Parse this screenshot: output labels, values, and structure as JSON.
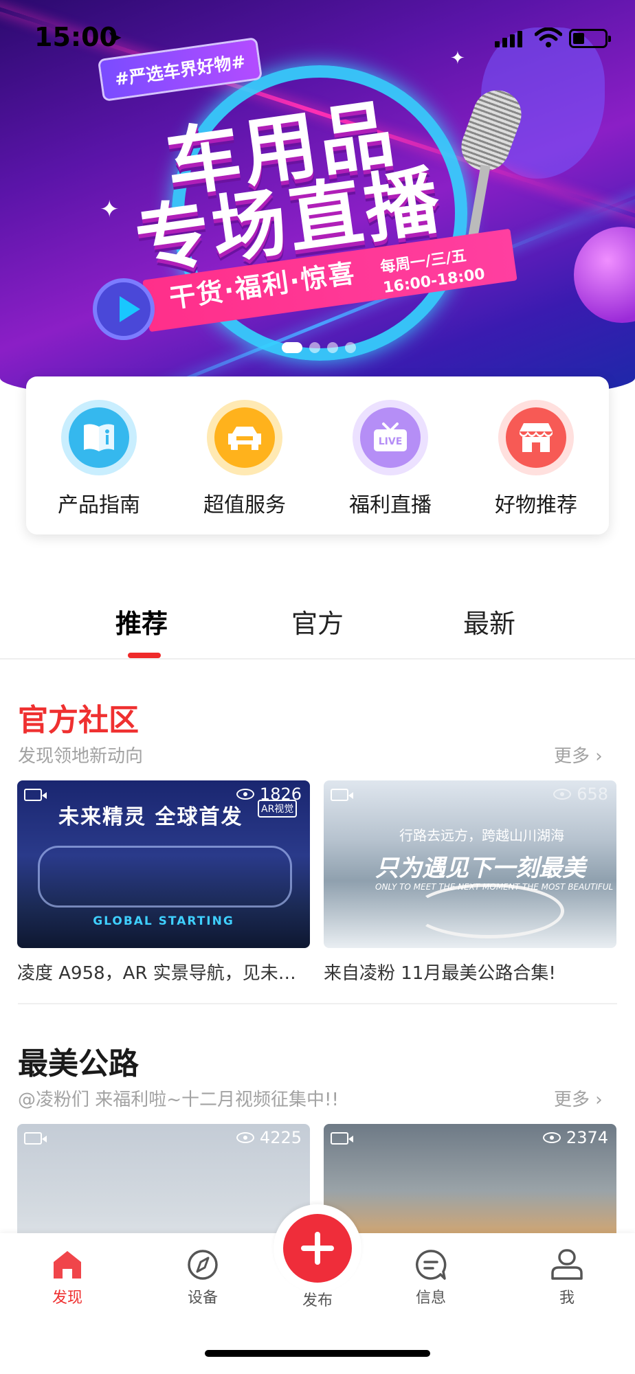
{
  "status_bar": {
    "time": "15:00"
  },
  "banner": {
    "tag": "#严选车界好物#",
    "title_line1": "车用品",
    "title_line2": "专场直播",
    "subtitle": "干货·福利·惊喜",
    "schedule_days": "每周一/三/五",
    "schedule_time": "16:00-18:00",
    "carousel_total": 4,
    "carousel_active": 1
  },
  "quick_entries": [
    {
      "label": "产品指南",
      "icon": "book-info-icon",
      "color": "#35b8ee"
    },
    {
      "label": "超值服务",
      "icon": "car-icon",
      "color": "#ffb21c"
    },
    {
      "label": "福利直播",
      "icon": "live-tv-icon",
      "color": "#b58ef6"
    },
    {
      "label": "好物推荐",
      "icon": "shop-icon",
      "color": "#f75a55"
    }
  ],
  "tabs": [
    {
      "label": "推荐",
      "active": true
    },
    {
      "label": "官方",
      "active": false
    },
    {
      "label": "最新",
      "active": false
    }
  ],
  "sections": [
    {
      "title": "官方社区",
      "subtitle": "发现领地新动向",
      "more": "更多",
      "cards": [
        {
          "views": "1826",
          "caption": "凌度 A958，AR 实景导航，见未…",
          "img_title": "未来精灵 全球首发",
          "img_badge": "AR视觉",
          "img_footer": "GLOBAL STARTING"
        },
        {
          "views": "658",
          "caption": "来自凌粉 11月最美公路合集!",
          "img_line1": "行路去远方，跨越山川湖海",
          "img_line2": "只为遇见下一刻最美",
          "img_line3": "ONLY TO MEET THE NEXT MOMENT THE MOST BEAUTIFUL"
        }
      ]
    },
    {
      "title": "最美公路",
      "subtitle": "@凌粉们 来福利啦~十二月视频征集中!!",
      "more": "更多",
      "cards": [
        {
          "views": "4225"
        },
        {
          "views": "2374"
        }
      ]
    }
  ],
  "bottom_nav": [
    {
      "label": "发现",
      "icon": "home-icon",
      "active": true
    },
    {
      "label": "设备",
      "icon": "compass-icon",
      "active": false
    },
    {
      "label": "发布",
      "icon": "plus-icon",
      "active": false
    },
    {
      "label": "信息",
      "icon": "message-icon",
      "active": false
    },
    {
      "label": "我",
      "icon": "user-icon",
      "active": false
    }
  ],
  "colors": {
    "accent": "#ef3030",
    "publish": "#ef2d3a"
  }
}
